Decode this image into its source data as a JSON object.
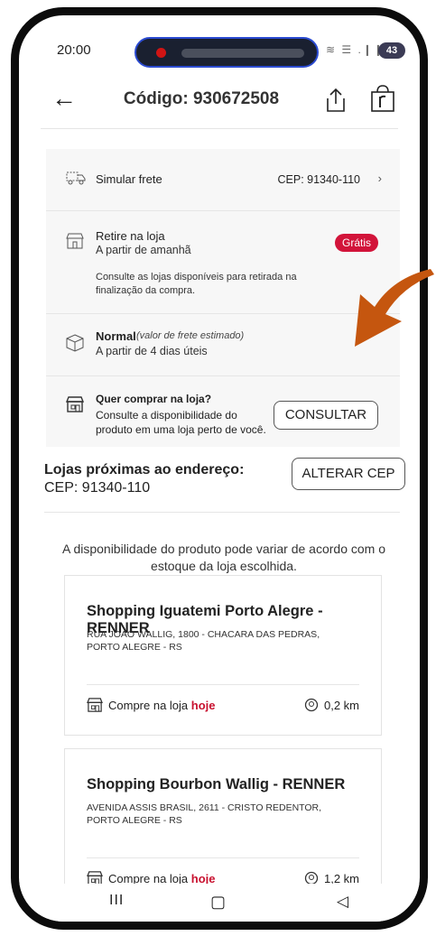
{
  "status": {
    "time": "20:00",
    "battery": "43",
    "icons": "≋ ☰ .❙❙"
  },
  "header": {
    "title": "Código: 930672508"
  },
  "shipping": {
    "simulate_label": "Simular frete",
    "cep_label": "CEP: 91340-110",
    "pickup_title": "Retire na loja",
    "pickup_sub": "A partir de amanhã",
    "pickup_badge": "Grátis",
    "pickup_note": "Consulte as lojas disponíveis para retirada na finalização da compra.",
    "normal_title": "Normal",
    "normal_note": "(valor de frete estimado)",
    "normal_sub": "A partir de 4 dias úteis",
    "store_q": "Quer comprar na loja?",
    "store_desc": "Consulte a disponibilidade do produto em uma loja perto de você.",
    "consult_button": "CONSULTAR"
  },
  "stores": {
    "title": "Lojas próximas ao endereço:",
    "cep": "CEP: 91340-110",
    "change_button": "ALTERAR CEP",
    "note": "A disponibilidade do produto pode variar de acordo com o estoque da loja escolhida.",
    "buy_prefix": "Compre na loja",
    "buy_highlight": "hoje",
    "items": [
      {
        "name": "Shopping Iguatemi Porto Alegre - RENNER",
        "address": "RUA JOAO WALLIG, 1800 - CHACARA DAS PEDRAS, PORTO ALEGRE - RS",
        "distance": "0,2 km"
      },
      {
        "name": "Shopping Bourbon Wallig - RENNER",
        "address": "AVENIDA ASSIS BRASIL, 2611 - CRISTO REDENTOR, PORTO ALEGRE - RS",
        "distance": "1,2 km"
      }
    ]
  },
  "navbar": {
    "recents": "III",
    "home": "▢",
    "back": "◁"
  },
  "colors": {
    "accent": "#d2143a",
    "arrow": "#c5560f"
  }
}
